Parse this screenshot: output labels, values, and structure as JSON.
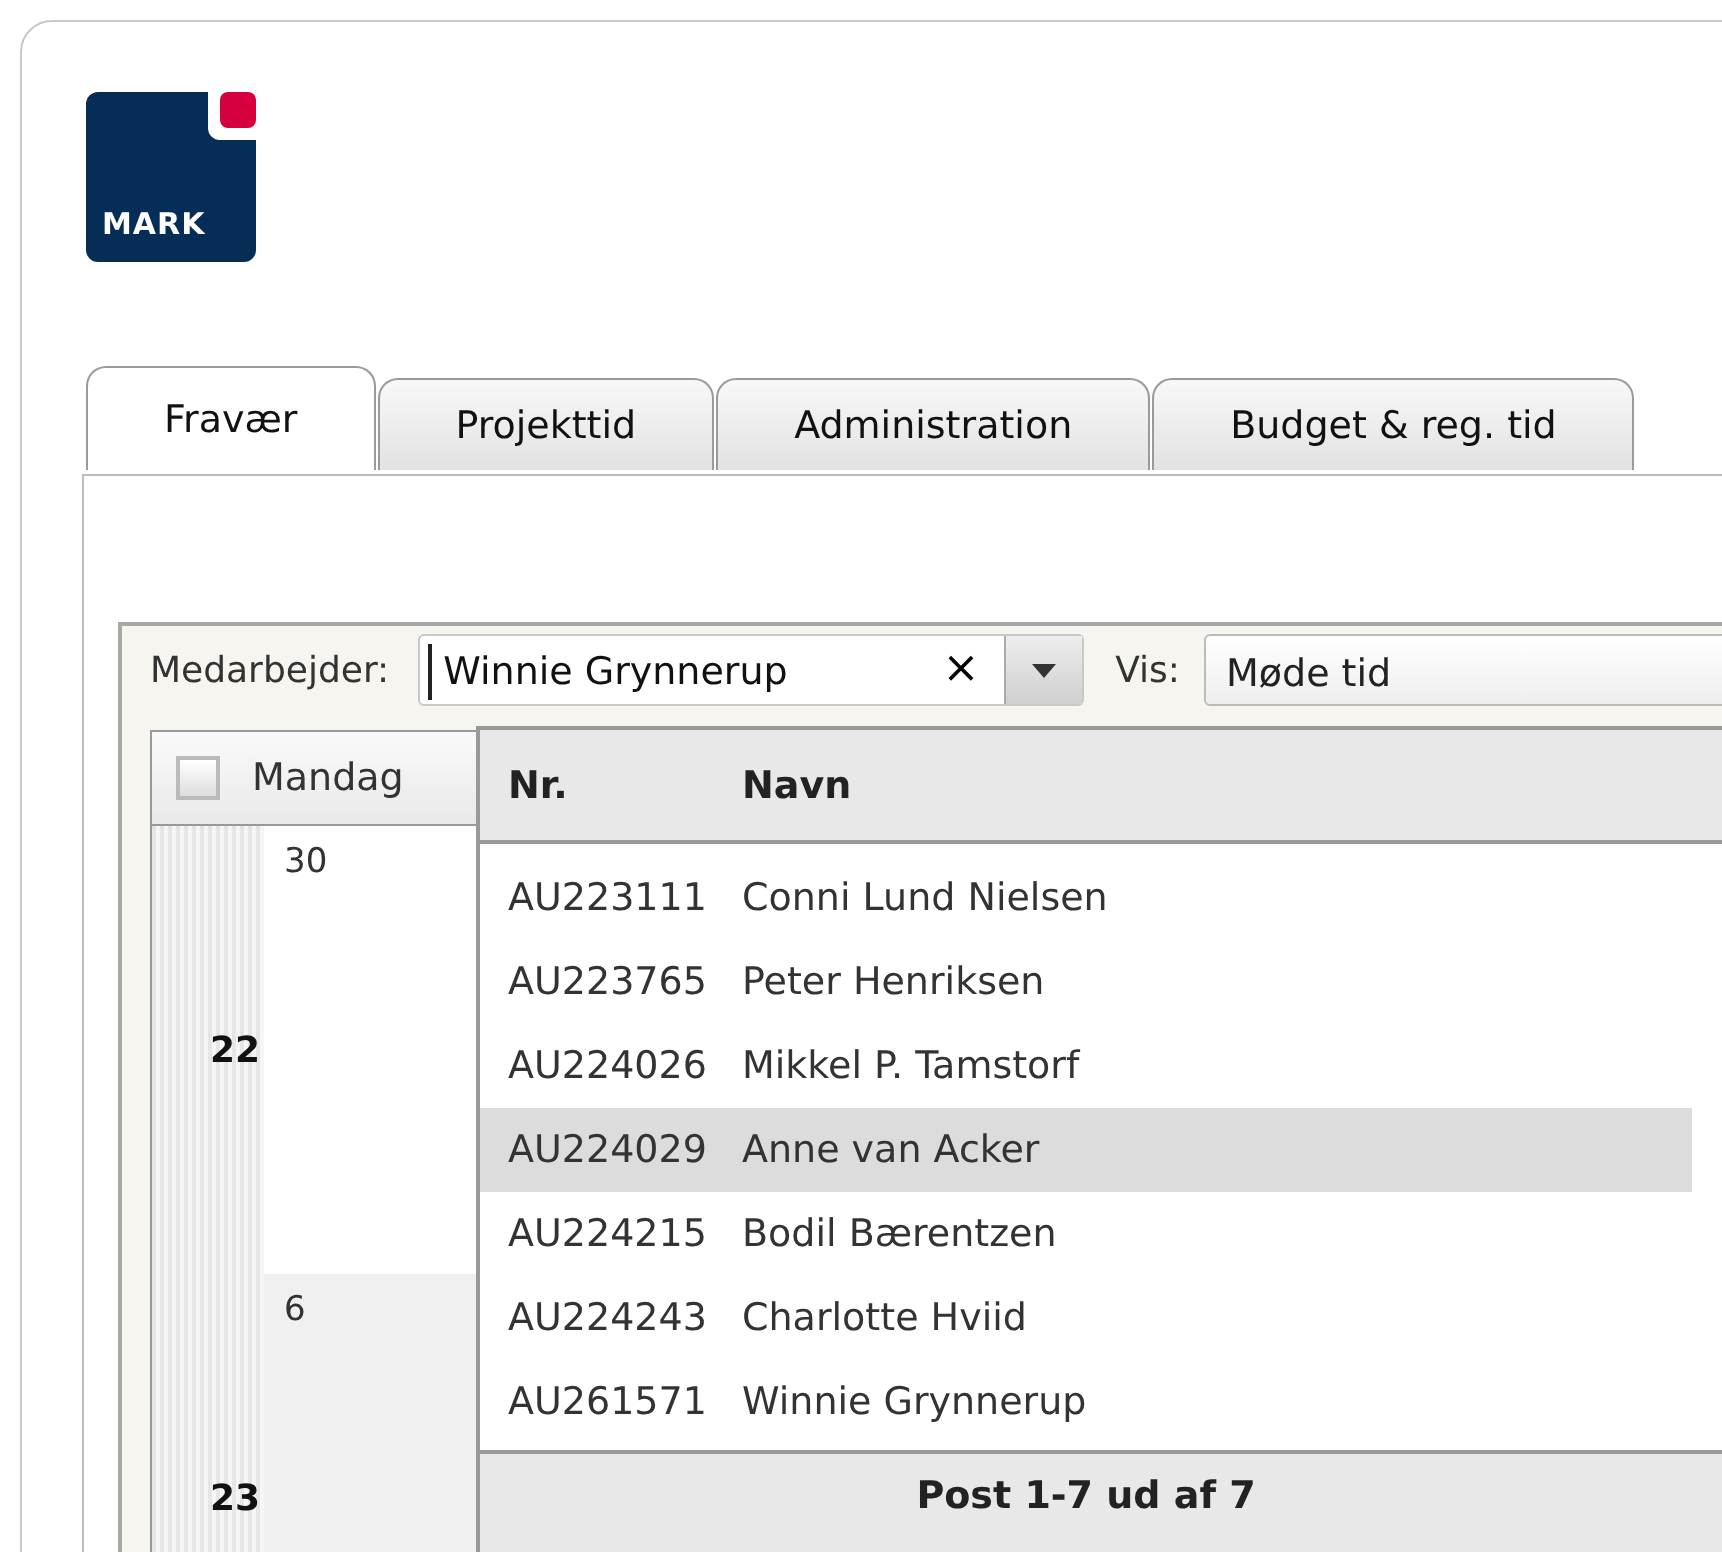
{
  "logo": {
    "text": "MARK"
  },
  "tabs": [
    {
      "label": "Fravær",
      "selected": true
    },
    {
      "label": "Projekttid",
      "selected": false
    },
    {
      "label": "Administration",
      "selected": false
    },
    {
      "label": "Budget & reg. tid",
      "selected": false
    }
  ],
  "toolbar": {
    "employee_label": "Medarbejder:",
    "employee_value": "Winnie Grynnerup",
    "clear": "×",
    "view_label": "Vis:",
    "view_value": "Møde tid"
  },
  "calendar": {
    "select_all_checked": false,
    "day_header": "Mandag",
    "weeks": [
      {
        "week": "22",
        "day": "30",
        "current_month": true
      },
      {
        "week": "23",
        "day": "6",
        "current_month": false
      }
    ]
  },
  "dropdown": {
    "columns": [
      "Nr.",
      "Navn"
    ],
    "rows": [
      {
        "nr": "AU223111",
        "name": "Conni Lund Nielsen",
        "selected": false
      },
      {
        "nr": "AU223765",
        "name": "Peter Henriksen",
        "selected": false
      },
      {
        "nr": "AU224026",
        "name": "Mikkel P. Tamstorf",
        "selected": false
      },
      {
        "nr": "AU224029",
        "name": "Anne van Acker",
        "selected": true
      },
      {
        "nr": "AU224215",
        "name": "Bodil Bærentzen",
        "selected": false
      },
      {
        "nr": "AU224243",
        "name": "Charlotte Hviid",
        "selected": false
      },
      {
        "nr": "AU261571",
        "name": "Winnie Grynnerup",
        "selected": false
      }
    ],
    "footer": "Post 1-7 ud af 7"
  }
}
